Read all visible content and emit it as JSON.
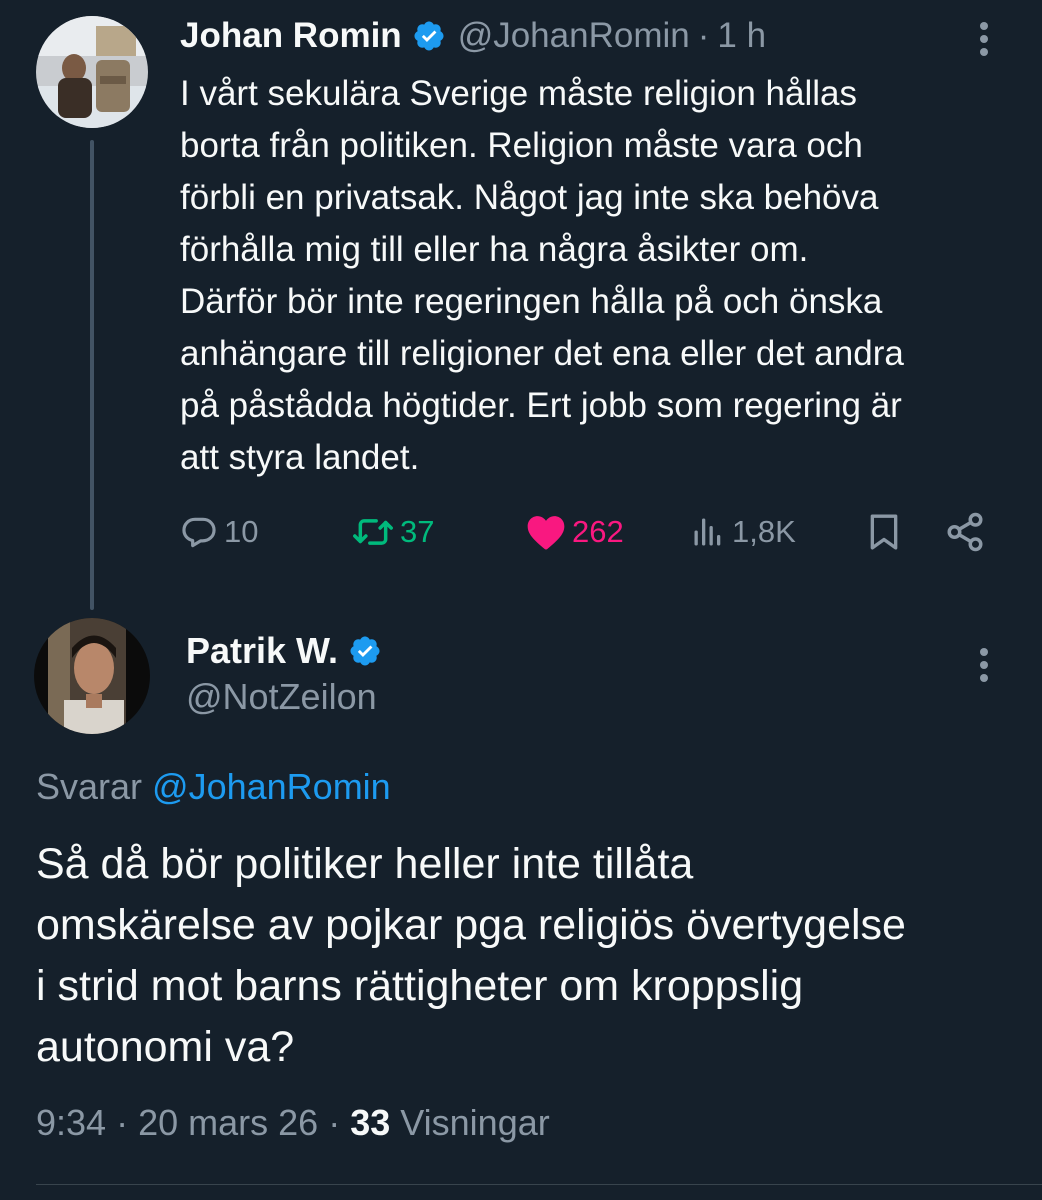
{
  "original_tweet": {
    "display_name": "Johan Romin",
    "handle": "@JohanRomin",
    "separator": "·",
    "time": "1 h",
    "text": "I vårt sekulära Sverige måste religion hållas\nborta från politiken. Religion måste vara och\nförbli en privatsak. Något jag inte ska behöva\nförhålla mig till eller ha några åsikter om.\nDärför bör inte regeringen hålla på och önska\nanhängare till religioner det ena eller det andra\npå påstådda högtider. Ert jobb som regering är\natt styra landet.",
    "actions": {
      "replies": "10",
      "retweets": "37",
      "likes": "262",
      "views": "1,8K"
    }
  },
  "reply_tweet": {
    "display_name": "Patrik W.",
    "handle": "@NotZeilon",
    "replying_prefix": "Svarar",
    "replying_to": "@JohanRomin",
    "text": "Så då bör politiker heller inte tillåta\nomskärelse av pojkar pga religiös övertygelse\ni strid mot barns rättigheter om kroppslig\nautonomi va?",
    "time": "9:34",
    "separator": "·",
    "date": "20 mars 26",
    "views_count": "33",
    "views_label": "Visningar"
  },
  "colors": {
    "background": "#15202b",
    "text_primary": "#f7f9f9",
    "text_secondary": "#8b98a5",
    "accent": "#1d9bf0",
    "retweet": "#00ba7c",
    "like": "#f91880"
  },
  "icons": {
    "verified": "verified-badge-icon",
    "more": "more-dots-icon",
    "reply": "reply-bubble-icon",
    "retweet": "retweet-icon",
    "like": "heart-icon",
    "views": "views-bars-icon",
    "bookmark": "bookmark-icon",
    "share": "share-icon"
  }
}
